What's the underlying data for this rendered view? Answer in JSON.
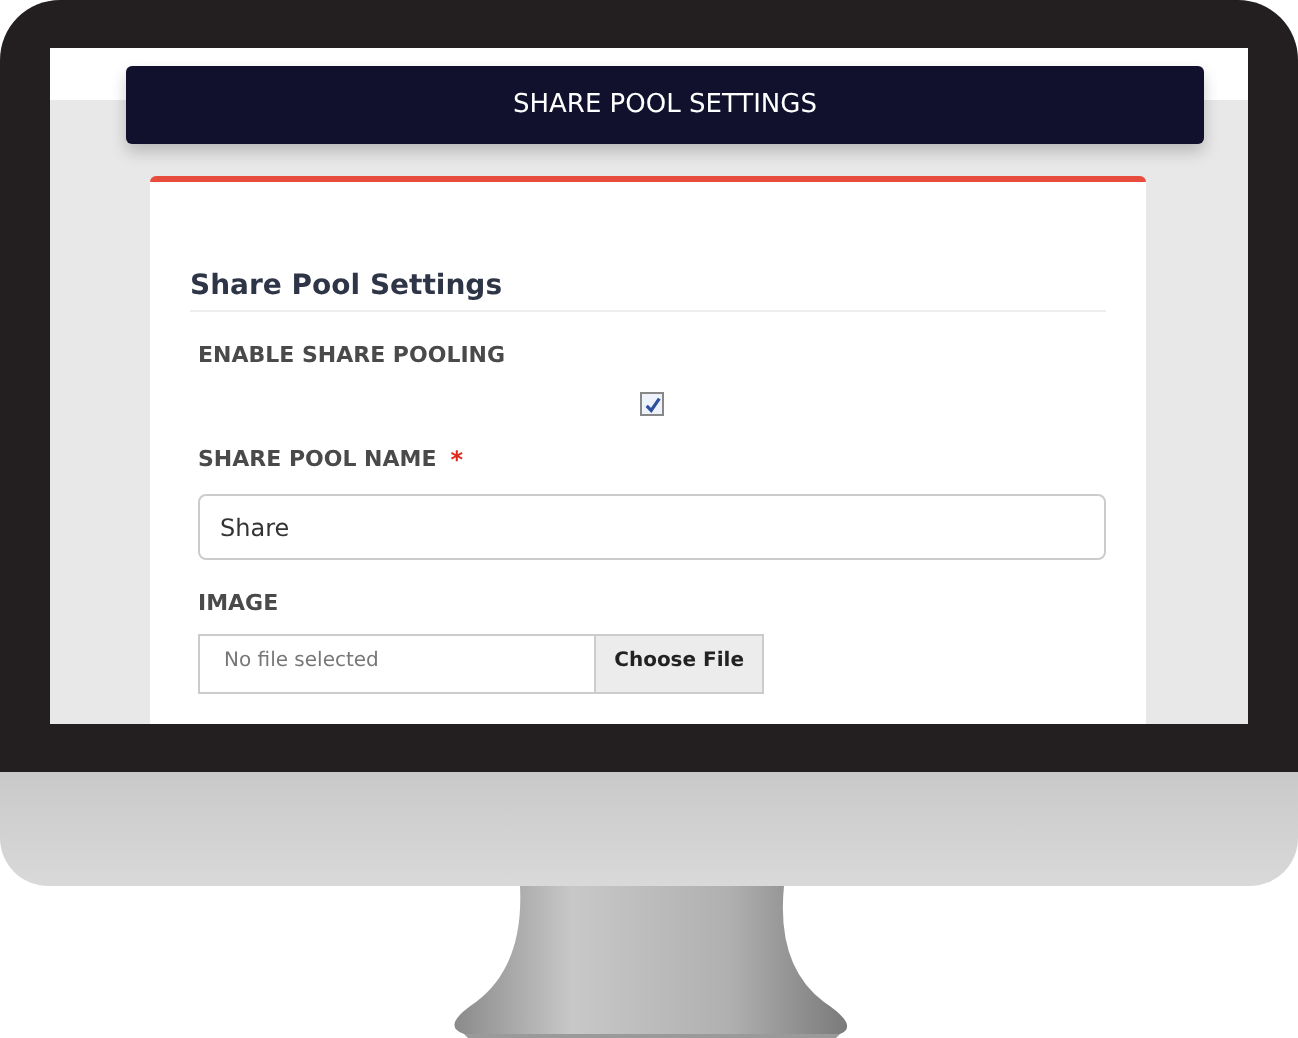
{
  "header": {
    "title": "SHARE POOL SETTINGS"
  },
  "section": {
    "title": "Share Pool Settings"
  },
  "fields": [
    {
      "kind": "checkbox",
      "label": "ENABLE SHARE POOLING",
      "checked": true
    },
    {
      "kind": "text",
      "label": "SHARE POOL NAME",
      "required_mark": "*",
      "value": "Share"
    },
    {
      "kind": "file",
      "label": "IMAGE",
      "status": "No file selected",
      "button": "Choose File"
    }
  ]
}
